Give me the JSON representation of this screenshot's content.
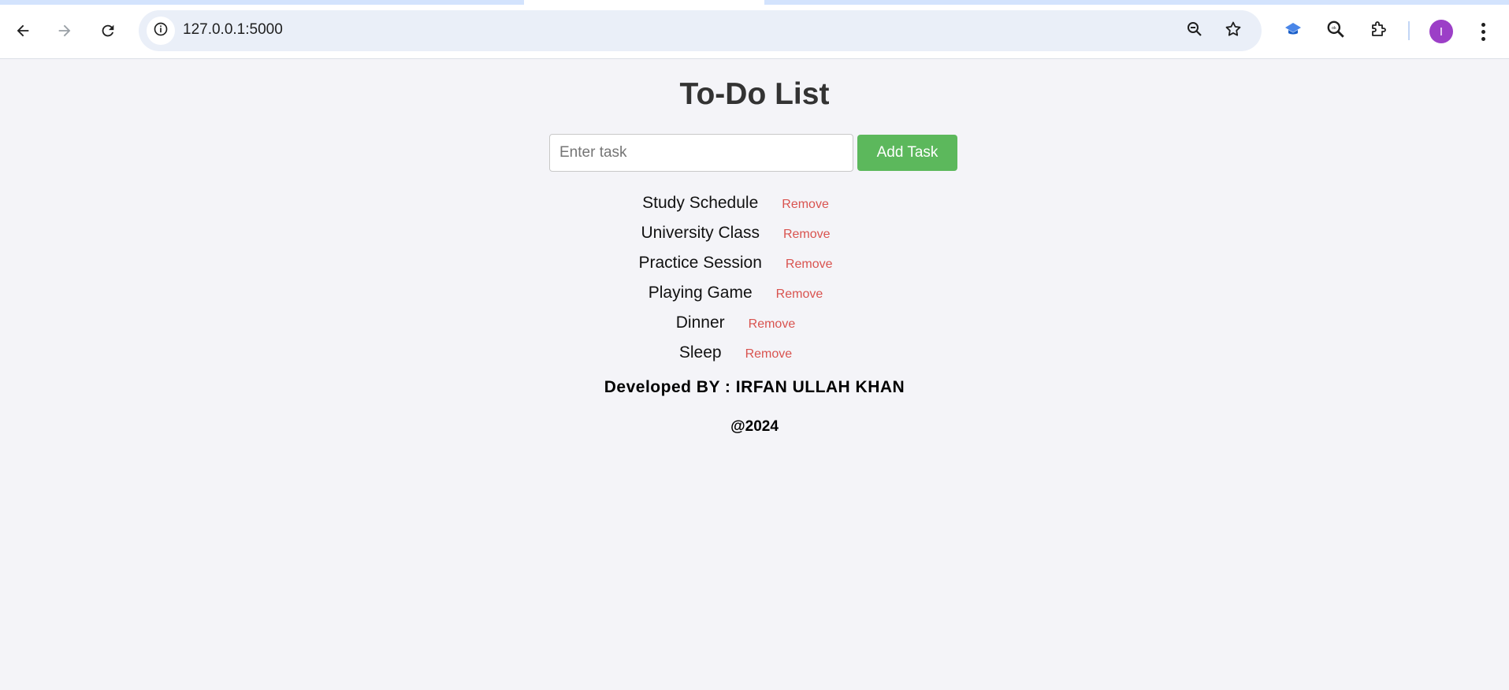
{
  "browser": {
    "url": "127.0.0.1:5000",
    "profile_initial": "I",
    "icons": {
      "back": "arrow-left-icon",
      "forward": "arrow-right-icon",
      "reload": "reload-icon",
      "site_info": "info-icon",
      "zoom": "zoom-out-icon",
      "bookmark": "star-icon",
      "extension_1": "graduation-cap-icon",
      "extension_2": "search-icon",
      "extensions": "puzzle-icon",
      "menu": "more-vert-icon"
    }
  },
  "page": {
    "title": "To-Do List",
    "input_placeholder": "Enter task",
    "input_value": "",
    "add_button_label": "Add Task",
    "tasks": [
      {
        "text": "Study Schedule",
        "remove_label": "Remove"
      },
      {
        "text": "University Class",
        "remove_label": "Remove"
      },
      {
        "text": "Practice Session",
        "remove_label": "Remove"
      },
      {
        "text": "Playing Game",
        "remove_label": "Remove"
      },
      {
        "text": "Dinner",
        "remove_label": "Remove"
      },
      {
        "text": "Sleep",
        "remove_label": "Remove"
      }
    ],
    "developer": "Developed BY : IRFAN ULLAH KHAN",
    "copyright": "@2024"
  },
  "colors": {
    "page_background": "#f4f4f8",
    "add_button": "#5cb85c",
    "remove_link": "#d9534f",
    "title": "#333333",
    "avatar": "#9c3fc7"
  }
}
